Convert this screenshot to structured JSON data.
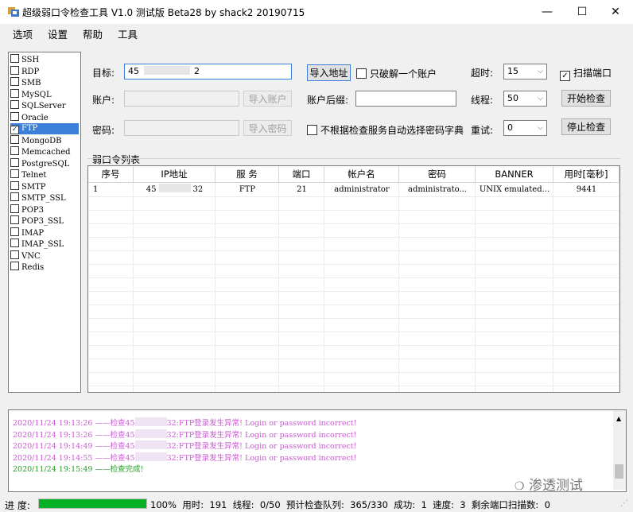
{
  "window": {
    "title": "超级弱口令检查工具 V1.0 测试版 Beta28 by shack2 20190715",
    "controls": {
      "minimize": "—",
      "maximize": "☐",
      "close": "✕"
    }
  },
  "menu": {
    "items": [
      "选项",
      "设置",
      "帮助",
      "工具"
    ]
  },
  "protocols": [
    {
      "label": "SSH",
      "checked": false
    },
    {
      "label": "RDP",
      "checked": false
    },
    {
      "label": "SMB",
      "checked": false
    },
    {
      "label": "MySQL",
      "checked": false
    },
    {
      "label": "SQLServer",
      "checked": false
    },
    {
      "label": "Oracle",
      "checked": false
    },
    {
      "label": "FTP",
      "checked": true,
      "selected": true
    },
    {
      "label": "MongoDB",
      "checked": false
    },
    {
      "label": "Memcached",
      "checked": false
    },
    {
      "label": "PostgreSQL",
      "checked": false
    },
    {
      "label": "Telnet",
      "checked": false
    },
    {
      "label": "SMTP",
      "checked": false
    },
    {
      "label": "SMTP_SSL",
      "checked": false
    },
    {
      "label": "POP3",
      "checked": false
    },
    {
      "label": "POP3_SSL",
      "checked": false
    },
    {
      "label": "IMAP",
      "checked": false
    },
    {
      "label": "IMAP_SSL",
      "checked": false
    },
    {
      "label": "VNC",
      "checked": false
    },
    {
      "label": "Redis",
      "checked": false
    }
  ],
  "form": {
    "target_label": "目标:",
    "target_value_a": "45",
    "target_value_b": "2",
    "account_label": "账户:",
    "password_label": "密码:",
    "import_address": "导入地址",
    "import_account": "导入账户",
    "import_password": "导入密码",
    "crack_one_label": "只破解一个账户",
    "account_suffix_label": "账户后缀:",
    "auto_dict_label": "不根据检查服务自动选择密码字典",
    "timeout_label": "超时:",
    "timeout_value": "15",
    "threads_label": "线程:",
    "threads_value": "50",
    "retry_label": "重试:",
    "retry_value": "0",
    "scan_port_label": "扫描端口",
    "start_button": "开始检查",
    "stop_button": "停止检查"
  },
  "table": {
    "group_label": "弱口令列表",
    "columns": [
      "序号",
      "IP地址",
      "服 务",
      "端口",
      "帐户名",
      "密码",
      "BANNER",
      "用时[毫秒]"
    ],
    "rows": [
      {
        "no": "1",
        "ip_a": "45",
        "ip_b": "32",
        "service": "FTP",
        "port": "21",
        "user": "administrator",
        "password": "administrato...",
        "banner": "UNIX emulated...",
        "time": "9441"
      }
    ]
  },
  "log": {
    "lines": [
      {
        "time": "2020/11/24 19:13:26",
        "sep": "——检查45",
        "msg": "32:FTP登录发生异常! Login or password incorrect!",
        "ok": false
      },
      {
        "time": "2020/11/24 19:13:26",
        "sep": "——检查45",
        "msg": "32:FTP登录发生异常! Login or password incorrect!",
        "ok": false
      },
      {
        "time": "2020/11/24 19:14:49",
        "sep": "——检查45",
        "msg": "32:FTP登录发生异常! Login or password incorrect!",
        "ok": false
      },
      {
        "time": "2020/11/24 19:14:55",
        "sep": "——检查45",
        "msg": "32:FTP登录发生异常! Login or password incorrect!",
        "ok": false
      },
      {
        "time": "2020/11/24 19:15:49",
        "sep": "——检查完成!",
        "msg": "",
        "ok": true
      }
    ],
    "watermark": "渗透测试"
  },
  "status": {
    "progress_label": "进 度:",
    "progress_percent": 100,
    "percent_text": "100%",
    "elapsed_label": "用时:",
    "elapsed_value": "191",
    "threads_label": "线程:",
    "threads_value": "0/50",
    "queue_label": "预计检查队列:",
    "queue_value": "365/330",
    "success_label": "成功:",
    "success_value": "1",
    "speed_label": "速度:",
    "speed_value": "3",
    "remaining_label": "剩余端口扫描数:",
    "remaining_value": "0"
  },
  "colors": {
    "selected": "#3c7fd8",
    "progress": "#06b025",
    "log_error": "#c85ad0",
    "log_ok": "#2a9a2a"
  }
}
